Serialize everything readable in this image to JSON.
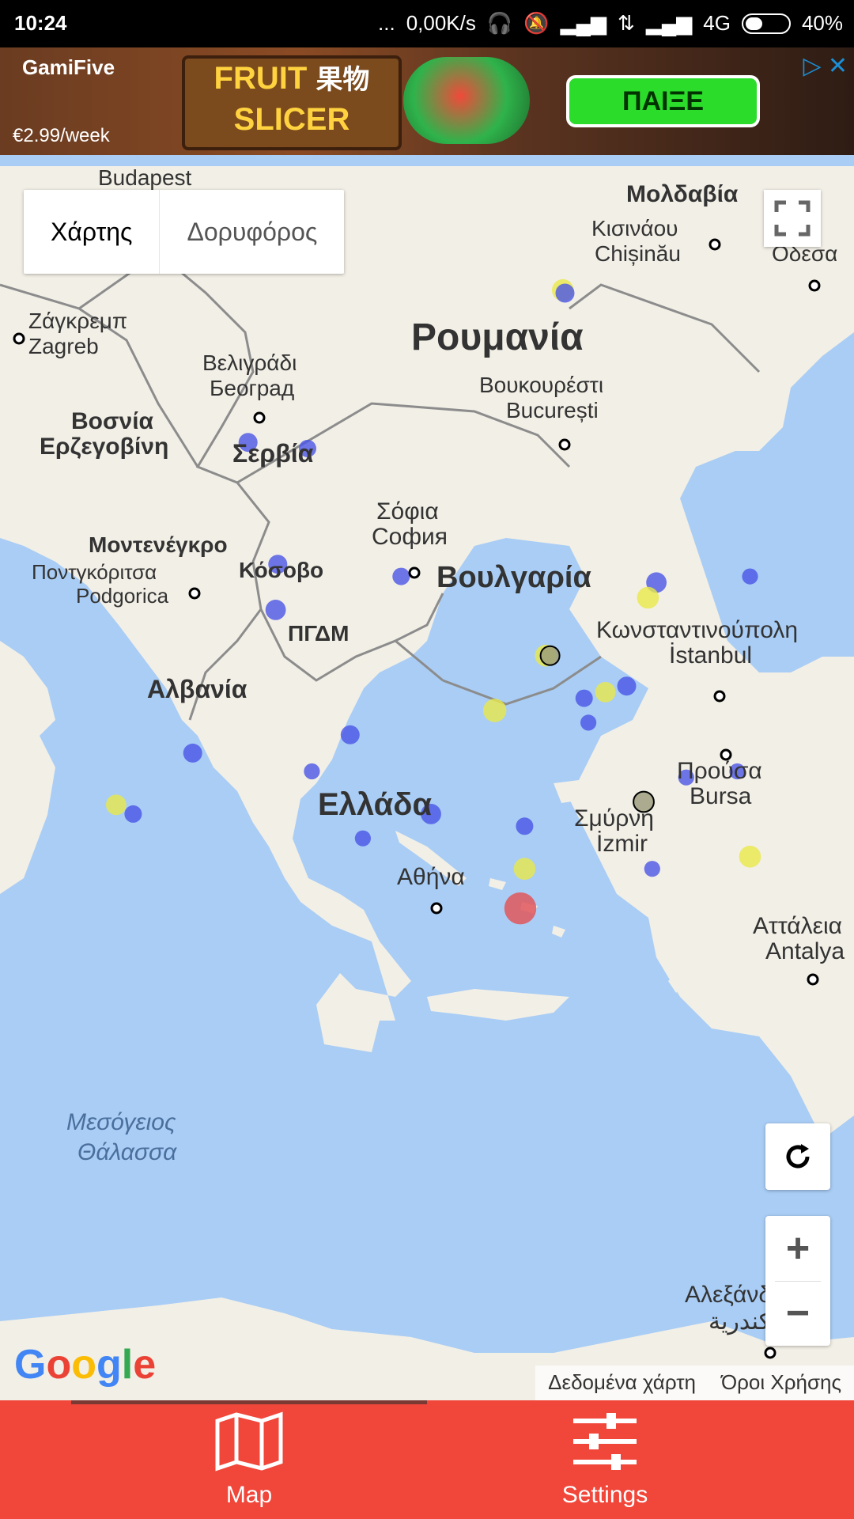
{
  "status_bar": {
    "time": "10:24",
    "dots": "...",
    "speed": "0,00K/s",
    "network": "4G",
    "battery_percent": "40%",
    "battery_level": 0.4
  },
  "ad": {
    "brand": "GamiFive",
    "game_title_line1": "FRUIT",
    "game_title_line2": "SLICER",
    "game_title_cjk": "果物",
    "price": "€2.99/week",
    "play_label": "ΠΑΙΞΕ"
  },
  "map": {
    "maptype_map": "Χάρτης",
    "maptype_satellite": "Δορυφόρος",
    "zoom_in": "+",
    "zoom_out": "−",
    "google_logo": "Google",
    "attribution_data": "Δεδομένα χάρτη",
    "attribution_terms": "Όροι Χρήσης",
    "labels": {
      "budapest": "Budapest",
      "moldova": "Μολδαβία",
      "kishinev_gr": "Κισινάου",
      "kishinev": "Chișinău",
      "odessa": "Οδεσα",
      "zagreb_gr": "Ζάγκρεμπ",
      "zagreb": "Zagreb",
      "romania": "Ρουμανία",
      "belgrade_gr": "Βελιγράδι",
      "belgrade": "Београд",
      "bucharest_gr": "Βουκουρέστι",
      "bucharest": "București",
      "bosnia1": "Βοσνία",
      "bosnia2": "Ερζεγοβίνη",
      "serbia": "Σερβία",
      "sofia_gr": "Σόφια",
      "sofia": "София",
      "montenegro": "Μοντενέγκρο",
      "podgorica_gr": "Ποντγκόριτσα",
      "podgorica": "Podgorica",
      "kosovo": "Κόσοβο",
      "bulgaria": "Βουλγαρία",
      "fyrom": "ΠΓΔΜ",
      "istanbul_gr": "Κωνσταντινούπολη",
      "istanbul": "İstanbul",
      "albania": "Αλβανία",
      "bursa_gr": "Προύσα",
      "bursa": "Bursa",
      "greece": "Ελλάδα",
      "izmir_gr": "Σμύρνη",
      "izmir": "İzmir",
      "athens": "Αθήνα",
      "antalya_gr": "Αττάλεια",
      "antalya": "Antalya",
      "med1": "Μεσόγειος",
      "med2": "Θάλασσα",
      "alexandria_gr": "Αλεξάνδρεια",
      "alexandria_ar": "الإسكندرية"
    }
  },
  "bottom_nav": {
    "map_label": "Map",
    "settings_label": "Settings"
  },
  "colors": {
    "nav_bg": "#f1463a",
    "sea": "#a9cdf5",
    "land": "#f2efe6",
    "quake_blue": "#4a55e6",
    "quake_yellow": "#e8e84a",
    "quake_red": "#e0565a"
  },
  "earthquakes": [
    {
      "lat": 45.4,
      "lon": 26.7,
      "mag": 3.0,
      "type": "yellow"
    },
    {
      "lat": 45.35,
      "lon": 26.75,
      "mag": 2.6,
      "type": "blue"
    },
    {
      "lat": 42.9,
      "lon": 19.3,
      "mag": 2.6,
      "type": "blue"
    },
    {
      "lat": 42.8,
      "lon": 20.7,
      "mag": 2.4,
      "type": "blue"
    },
    {
      "lat": 40.9,
      "lon": 20.0,
      "mag": 2.6,
      "type": "blue"
    },
    {
      "lat": 40.7,
      "lon": 22.9,
      "mag": 2.4,
      "type": "blue"
    },
    {
      "lat": 40.15,
      "lon": 19.95,
      "mag": 2.8,
      "type": "blue"
    },
    {
      "lat": 40.6,
      "lon": 28.9,
      "mag": 2.8,
      "type": "blue"
    },
    {
      "lat": 40.35,
      "lon": 28.7,
      "mag": 3.0,
      "type": "yellow"
    },
    {
      "lat": 39.4,
      "lon": 26.3,
      "mag": 3.0,
      "type": "yellow"
    },
    {
      "lat": 39.4,
      "lon": 26.4,
      "mag": 2.6,
      "type": "gray"
    },
    {
      "lat": 38.9,
      "lon": 28.2,
      "mag": 2.6,
      "type": "blue"
    },
    {
      "lat": 38.8,
      "lon": 27.7,
      "mag": 2.8,
      "type": "yellow"
    },
    {
      "lat": 38.7,
      "lon": 27.2,
      "mag": 2.4,
      "type": "blue"
    },
    {
      "lat": 38.5,
      "lon": 25.1,
      "mag": 3.2,
      "type": "yellow"
    },
    {
      "lat": 38.3,
      "lon": 27.3,
      "mag": 2.2,
      "type": "blue"
    },
    {
      "lat": 38.1,
      "lon": 21.7,
      "mag": 2.6,
      "type": "blue"
    },
    {
      "lat": 37.8,
      "lon": 18.0,
      "mag": 2.6,
      "type": "blue"
    },
    {
      "lat": 37.5,
      "lon": 20.8,
      "mag": 2.2,
      "type": "blue"
    },
    {
      "lat": 37.4,
      "lon": 29.6,
      "mag": 2.2,
      "type": "blue"
    },
    {
      "lat": 37.5,
      "lon": 30.8,
      "mag": 2.2,
      "type": "blue"
    },
    {
      "lat": 37.0,
      "lon": 28.6,
      "mag": 2.8,
      "type": "gray"
    },
    {
      "lat": 36.95,
      "lon": 16.2,
      "mag": 2.8,
      "type": "yellow"
    },
    {
      "lat": 36.8,
      "lon": 16.6,
      "mag": 2.4,
      "type": "blue"
    },
    {
      "lat": 36.8,
      "lon": 23.6,
      "mag": 2.8,
      "type": "blue"
    },
    {
      "lat": 36.6,
      "lon": 25.8,
      "mag": 2.4,
      "type": "blue"
    },
    {
      "lat": 36.4,
      "lon": 22.0,
      "mag": 2.2,
      "type": "blue"
    },
    {
      "lat": 36.1,
      "lon": 31.1,
      "mag": 3.0,
      "type": "yellow"
    },
    {
      "lat": 35.9,
      "lon": 25.8,
      "mag": 3.0,
      "type": "yellow"
    },
    {
      "lat": 35.9,
      "lon": 28.8,
      "mag": 2.2,
      "type": "blue"
    },
    {
      "lat": 35.25,
      "lon": 25.7,
      "mag": 4.4,
      "type": "red"
    },
    {
      "lat": 40.7,
      "lon": 31.1,
      "mag": 2.2,
      "type": "blue"
    }
  ]
}
